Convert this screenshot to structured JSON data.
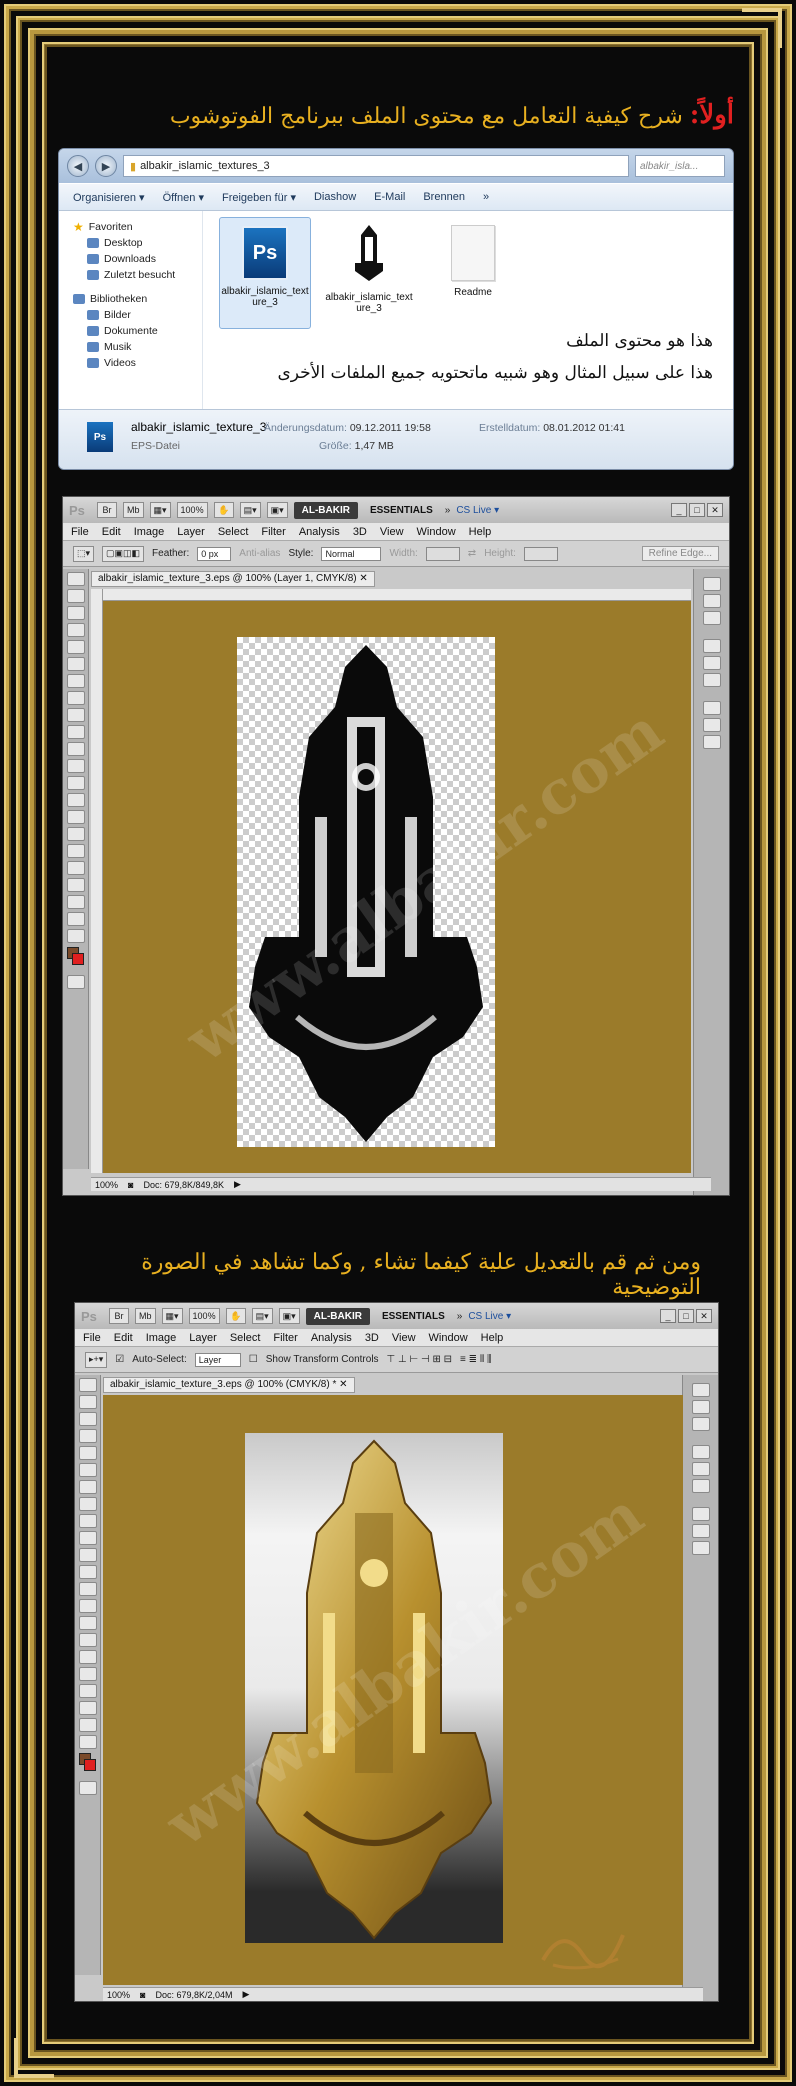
{
  "headings": {
    "first_label": "أولاً:",
    "first_text": "شرح كيفية التعامل مع محتوى الملف ببرنامج الفوتوشوب",
    "second_text": "ومن ثم قم بالتعديل علية كيفما تشاء , وكما تشاهد في الصورة التوضيحية"
  },
  "explorer": {
    "path": "albakir_islamic_textures_3",
    "search_placeholder": "albakir_isla...",
    "toolbar": [
      "Organisieren ▾",
      "Öffnen ▾",
      "Freigeben für ▾",
      "Diashow",
      "E-Mail",
      "Brennen",
      "»"
    ],
    "sidebar": {
      "favorites": "Favoriten",
      "favorite_items": [
        "Desktop",
        "Downloads",
        "Zuletzt besucht"
      ],
      "libraries": "Bibliotheken",
      "library_items": [
        "Bilder",
        "Dokumente",
        "Musik",
        "Videos"
      ]
    },
    "files": [
      {
        "name": "albakir_islamic_texture_3",
        "type": "ps"
      },
      {
        "name": "albakir_islamic_texture_3",
        "type": "image"
      },
      {
        "name": "Readme",
        "type": "doc"
      }
    ],
    "note1": "هذا هو محتوى الملف",
    "note2": "هذا على سبيل المثال وهو شبيه ماتحتويه جميع الملفات الأخرى",
    "status": {
      "filename": "albakir_islamic_texture_3",
      "filetype": "EPS-Datei",
      "modified_label": "Änderungsdatum:",
      "modified": "09.12.2011 19:58",
      "size_label": "Größe:",
      "size": "1,47 MB",
      "created_label": "Erstelldatum:",
      "created": "08.01.2012 01:41"
    }
  },
  "ps": {
    "logo": "Ps",
    "zoom": "100%",
    "workspace_active": "AL-BAKIR",
    "workspace_other": "ESSENTIALS",
    "cslive": "CS Live ▾",
    "menu": [
      "File",
      "Edit",
      "Image",
      "Layer",
      "Select",
      "Filter",
      "Analysis",
      "3D",
      "View",
      "Window",
      "Help"
    ],
    "window1": {
      "feather_label": "Feather:",
      "feather_value": "0 px",
      "antialias": "Anti-alias",
      "style_label": "Style:",
      "style_value": "Normal",
      "width_label": "Width:",
      "height_label": "Height:",
      "refine": "Refine Edge...",
      "tab": "albakir_islamic_texture_3.eps @ 100% (Layer 1, CMYK/8)",
      "status_zoom": "100%",
      "doc": "Doc: 679,8K/849,8K"
    },
    "window2": {
      "auto_select": "Auto-Select:",
      "layer": "Layer",
      "transform": "Show Transform Controls",
      "tab": "albakir_islamic_texture_3.eps @ 100% (CMYK/8) *",
      "status_zoom": "100%",
      "doc": "Doc: 679,8K/2,04M"
    }
  },
  "watermark": "www.albakir.com",
  "colors": {
    "gold": "#c9a94a",
    "canvas": "#9b7b2a",
    "heading": "#e8b020"
  }
}
